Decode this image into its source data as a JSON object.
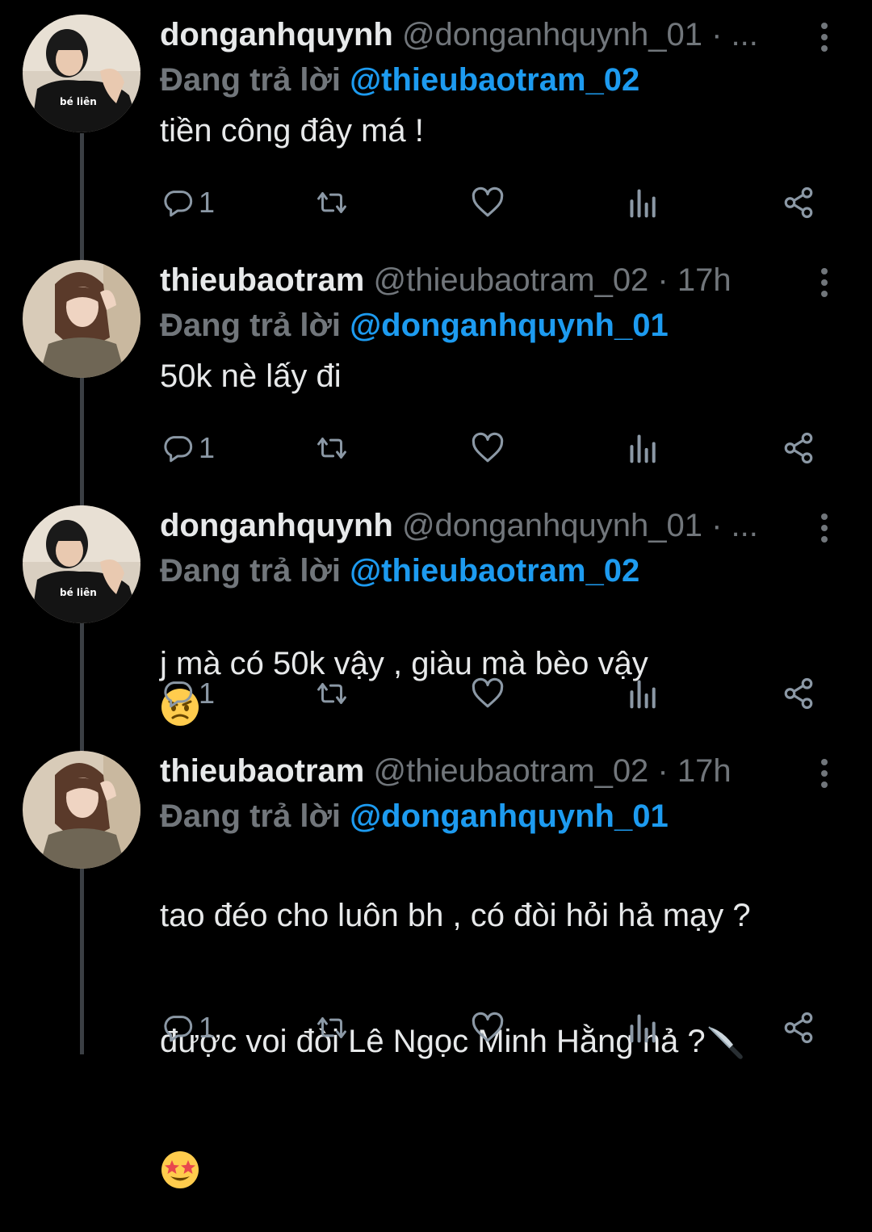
{
  "colors": {
    "background": "#000000",
    "text": "#e7e9ea",
    "secondary": "#71767b",
    "link": "#1d9bf0",
    "thread_line": "#3b3f44"
  },
  "avatars": {
    "user1_shirt_text": "bé liên"
  },
  "tweets": [
    {
      "display_name": "donganhquynh",
      "meta": "@donganhquynh_01 · ...",
      "reply_prefix": "Đang trả lời",
      "reply_mention": "@thieubaotram_02",
      "text": "tiền công đây má !",
      "reply_count": "1"
    },
    {
      "display_name": "thieubaotram",
      "meta": "@thieubaotram_02 · 17h",
      "reply_prefix": "Đang trả lời",
      "reply_mention": "@donganhquynh_01",
      "text": "50k nè lấy đi",
      "reply_count": "1"
    },
    {
      "display_name": "donganhquynh",
      "meta": "@donganhquynh_01 · ...",
      "reply_prefix": "Đang trả lời",
      "reply_mention": "@thieubaotram_02",
      "text": "j mà có 50k vậy , giàu mà bèo vậy",
      "reply_count": "1"
    },
    {
      "display_name": "thieubaotram",
      "meta": "@thieubaotram_02 · 17h",
      "reply_prefix": "Đang trả lời",
      "reply_mention": "@donganhquynh_01",
      "text_line1": "tao đéo cho luôn bh , có đòi hỏi hả mạy ?",
      "text_line2": "được voi đòi Lê Ngọc Minh Hằng hả ?",
      "reply_count": "1"
    }
  ],
  "icons": {
    "reply": "reply-bubble-icon",
    "retweet": "retweet-icon",
    "like": "heart-icon",
    "views": "views-chart-icon",
    "share": "share-icon",
    "more": "more-vertical-icon",
    "emoji_angry": "angry-face-emoji-icon",
    "emoji_knife": "knife-emoji-icon",
    "emoji_star_eyes": "star-struck-emoji-icon"
  }
}
